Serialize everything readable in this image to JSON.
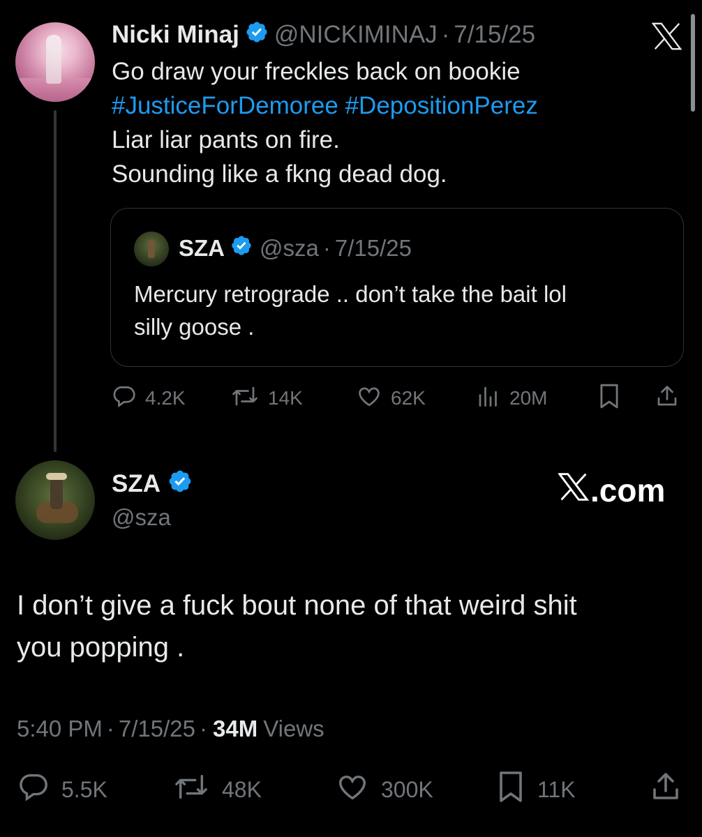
{
  "quoted_tweet_author": {
    "name": "Nicki Minaj",
    "handle": "@NICKIMINAJ",
    "date": "7/15/25"
  },
  "tweet1": {
    "line1": "Go draw your freckles back on bookie",
    "hashtag1": "#JusticeForDemoree",
    "hashtag2": "#DepositionPerez",
    "line3": "Liar liar pants on fire.",
    "line4": "Sounding like a fkng dead dog."
  },
  "quote": {
    "name": "SZA",
    "handle": "@sza",
    "date": "7/15/25",
    "line1": "Mercury retrograde .. don’t take the bait lol",
    "line2": "silly goose ."
  },
  "tweet1_actions": {
    "replies": "4.2K",
    "reposts": "14K",
    "likes": "62K",
    "views": "20M"
  },
  "reply": {
    "name": "SZA",
    "handle": "@sza",
    "watermark": ".com",
    "line1": "I don’t give a fuck bout none of that weird shit",
    "line2": "you popping .",
    "time": "5:40 PM",
    "date": "7/15/25",
    "views_count": "34M",
    "views_label": "Views",
    "sep": "·"
  },
  "reply_actions": {
    "replies": "5.5K",
    "reposts": "48K",
    "likes": "300K",
    "bookmarks": "11K"
  },
  "colors": {
    "background": "#000000",
    "text": "#e7e9ea",
    "muted": "#71767b",
    "link": "#1d9bf0",
    "verified": "#1d9bf0",
    "border": "#2f3336"
  }
}
